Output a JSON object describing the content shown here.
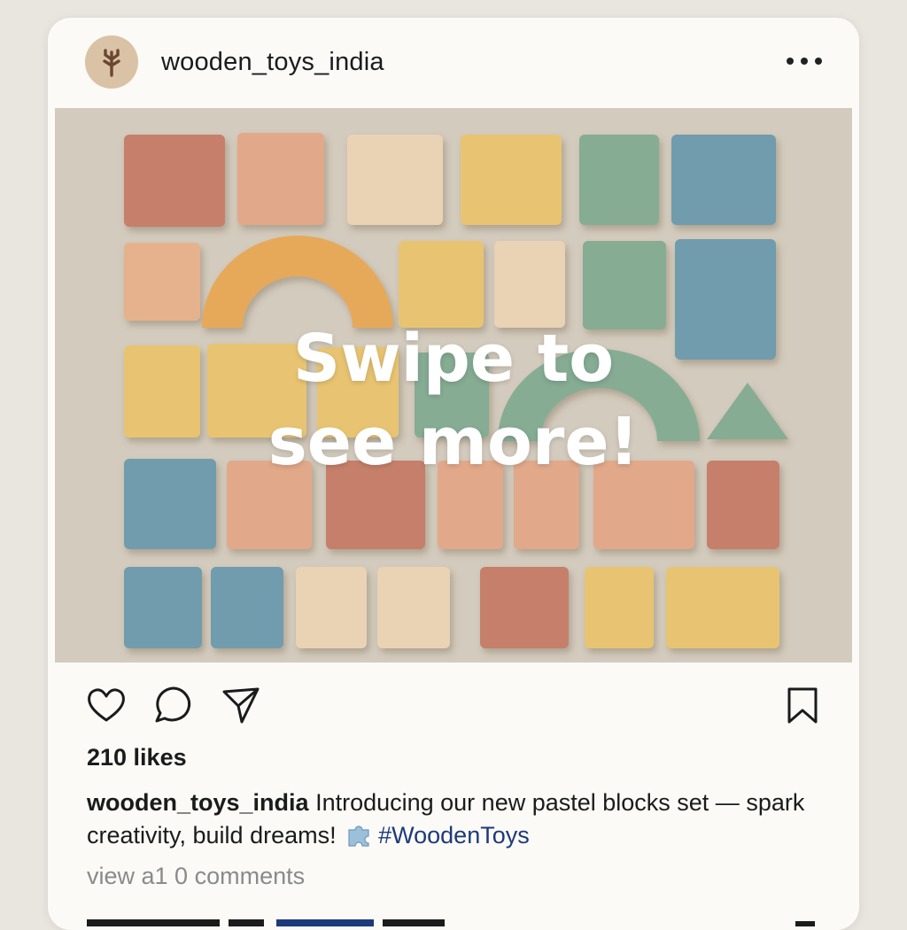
{
  "post": {
    "username": "wooden_toys_india",
    "overlay_line1": "Swipe to",
    "overlay_line2": "see more!",
    "likes": "210 likes",
    "caption_user": "wooden_toys_india",
    "caption_text": "Introducing our new pastel blocks set — spark creativity, build dreams!",
    "hashtag": "#WoodenToys",
    "view_comments": "view a1 0 comments"
  },
  "icons": {
    "avatar": "tree-icon",
    "more": "more-options-icon",
    "like": "heart-icon",
    "comment": "comment-icon",
    "share": "send-icon",
    "save": "bookmark-icon",
    "caption_emoji": "puzzle-piece-icon"
  },
  "colors": {
    "hashtag": "#1d3a7a",
    "avatar_bg": "#d9c2a5",
    "block_terracotta": "#c67f6b",
    "block_peach": "#e2a88a",
    "block_cream": "#ead2b4",
    "block_mustard": "#e8c472",
    "block_sage": "#86ac94",
    "block_blue": "#6f9cad"
  }
}
